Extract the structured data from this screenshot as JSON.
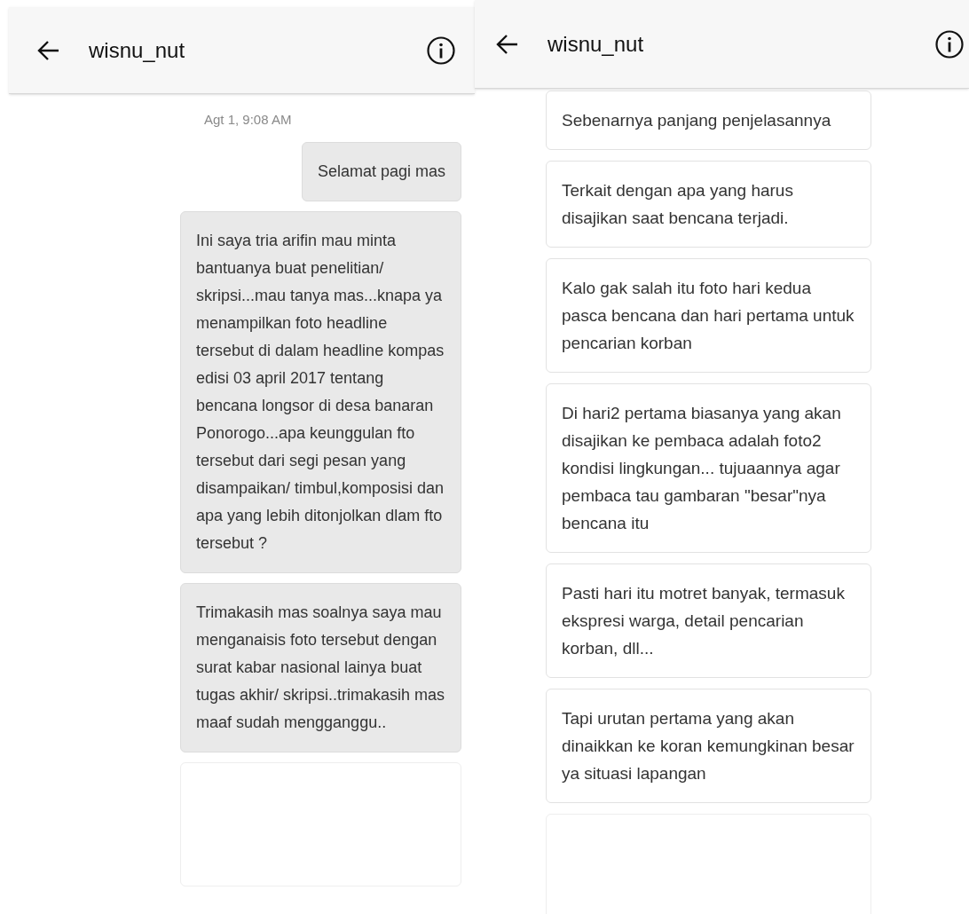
{
  "panels": [
    {
      "header": {
        "title": "wisnu_nut"
      },
      "timestamp": "Agt 1, 9:08 AM",
      "messages": [
        {
          "kind": "sent",
          "text": "Selamat pagi mas"
        },
        {
          "kind": "sent",
          "text": "Ini saya tria arifin mau minta bantuanya buat penelitian/ skripsi...mau tanya mas...knapa ya menampilkan foto headline tersebut di dalam headline kompas edisi 03 april 2017 tentang bencana longsor di desa banaran Ponorogo...apa keunggulan fto tersebut dari segi pesan yang disampaikan/ timbul,komposisi dan apa yang lebih ditonjolkan dlam fto tersebut ?"
        },
        {
          "kind": "sent",
          "text": "Trimakasih mas soalnya saya mau menganaisis foto tersebut dengan surat kabar nasional lainya buat tugas akhir/ skripsi..trimakasih mas maaf sudah mengganggu.."
        }
      ]
    },
    {
      "header": {
        "title": "wisnu_nut"
      },
      "messages": [
        {
          "kind": "received",
          "text": "Sebenarnya panjang penjelasannya"
        },
        {
          "kind": "received",
          "text": "Terkait dengan apa yang harus disajikan saat bencana terjadi."
        },
        {
          "kind": "received",
          "text": "Kalo gak salah itu foto hari kedua pasca bencana dan hari pertama untuk pencarian korban"
        },
        {
          "kind": "received",
          "text": "Di hari2 pertama biasanya yang akan disajikan ke pembaca adalah foto2 kondisi lingkungan... tujuaannya agar pembaca tau gambaran \"besar\"nya bencana itu"
        },
        {
          "kind": "received",
          "text": "Pasti hari itu motret banyak, termasuk ekspresi warga, detail pencarian korban, dll..."
        },
        {
          "kind": "received",
          "text": "Tapi urutan pertama yang akan dinaikkan ke koran kemungkinan besar ya situasi lapangan"
        }
      ]
    }
  ]
}
